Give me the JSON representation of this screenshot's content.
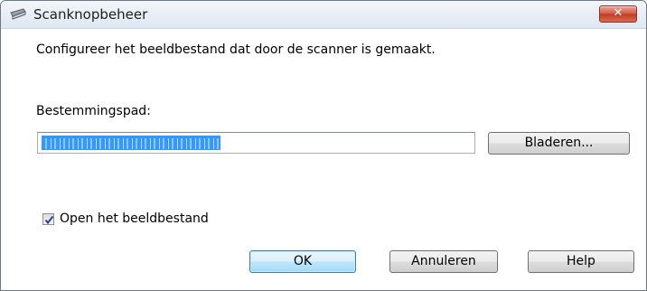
{
  "window": {
    "title": "Scanknopbeheer",
    "app_icon": "scanner-icon",
    "close_icon": "close-icon",
    "close_label": "✕"
  },
  "main": {
    "instruction": "Configureer het beeldbestand dat door de scanner is gemaakt.",
    "destination_label": "Bestemmingspad:",
    "destination_value": "",
    "destination_selected": true,
    "browse_label": "Bladeren...",
    "open_image_label": "Open het beeldbestand",
    "open_image_checked": true
  },
  "buttons": {
    "ok_label": "OK",
    "cancel_label": "Annuleren",
    "help_label": "Help"
  },
  "colors": {
    "selection": "#3399ff",
    "close_button": "#c23a22"
  }
}
